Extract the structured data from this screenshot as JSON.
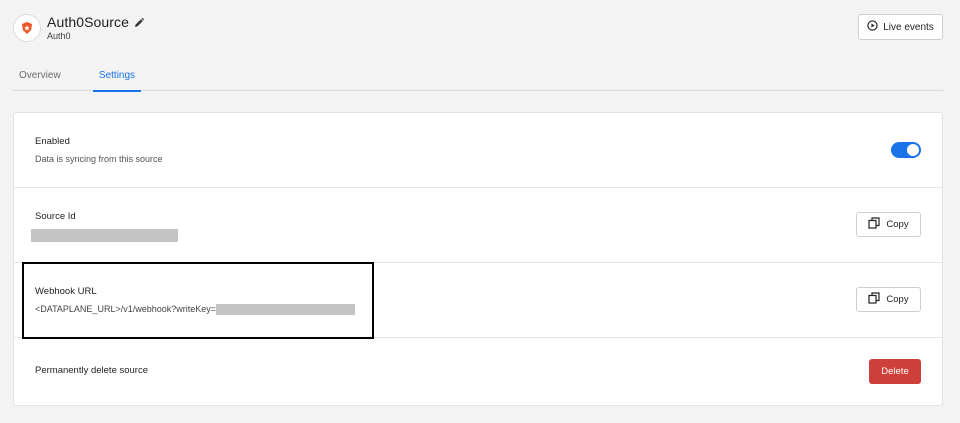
{
  "header": {
    "title": "Auth0Source",
    "subtitle": "Auth0",
    "logo_icon": "auth0-shield-icon",
    "edit_icon": "pencil-icon",
    "live_events_label": "Live events",
    "live_events_icon": "play-circle-icon"
  },
  "tabs": [
    {
      "label": "Overview",
      "active": false
    },
    {
      "label": "Settings",
      "active": true
    }
  ],
  "settings": {
    "enabled": {
      "label": "Enabled",
      "description": "Data is syncing from this source",
      "toggle_on": true
    },
    "source_id": {
      "label": "Source Id",
      "copy_label": "Copy"
    },
    "webhook": {
      "label": "Webhook URL",
      "url_prefix": "<DATAPLANE_URL>/v1/webhook?writeKey=",
      "copy_label": "Copy"
    },
    "delete": {
      "label": "Permanently delete source",
      "button_label": "Delete"
    }
  },
  "colors": {
    "accent": "#1a73e8",
    "danger": "#d0403a",
    "logo_red": "#eb5424"
  }
}
